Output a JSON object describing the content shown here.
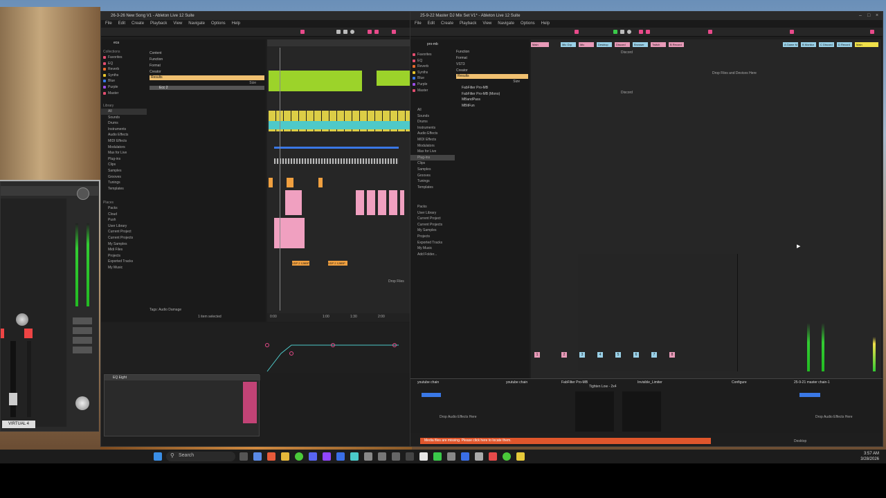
{
  "left_window": {
    "title": "26-3-26 New Song V1 - Ableton Live 12 Suite",
    "menus": [
      "File",
      "Edit",
      "Create",
      "Playback",
      "View",
      "Navigate",
      "Options",
      "Help"
    ],
    "search_value": "eca",
    "browser_filters": [
      "Content",
      "Function",
      "Format",
      "Creator"
    ],
    "results_label": "Results",
    "size_label": "Size",
    "result_item": "Ecc 2",
    "collections_label": "Collections",
    "collections": [
      {
        "label": "Favorites",
        "color": "#e34d6f"
      },
      {
        "label": "EQ",
        "color": "#e34d6f"
      },
      {
        "label": "Reverb",
        "color": "#e86a2c"
      },
      {
        "label": "Synths",
        "color": "#e8c42c"
      },
      {
        "label": "Blue",
        "color": "#3a78e6"
      },
      {
        "label": "Purple",
        "color": "#9a4de6"
      },
      {
        "label": "Master",
        "color": "#e34d6f"
      }
    ],
    "library_label": "Library",
    "library": [
      "All",
      "Sounds",
      "Drums",
      "Instruments",
      "Audio Effects",
      "MIDI Effects",
      "Modulators",
      "Max for Live",
      "Plug-ins",
      "Clips",
      "Samples",
      "Grooves",
      "Tunings",
      "Templates"
    ],
    "places_label": "Places",
    "places": [
      "Packs",
      "Cloud",
      "Push",
      "User Library",
      "Current Project",
      "Current Projects",
      "My Samples",
      "Midi Files",
      "Projects",
      "Exported Tracks",
      "My Music"
    ],
    "tags_label": "Tags",
    "tags_value": "Audio Damage",
    "status": "1 item selected",
    "drop_files": "Drop Files",
    "clip_labels": [
      "VDP 2 128BP",
      "VDP 2 128BP"
    ],
    "device_title": "EQ Eight",
    "timeline_markers": [
      "0:00",
      "1:00",
      "1:30",
      "2:00"
    ]
  },
  "right_window": {
    "title": "25-9-22 Master DJ Mix Set V1* - Ableton Live 12 Suite",
    "menus": [
      "File",
      "Edit",
      "Create",
      "Playback",
      "View",
      "Navigate",
      "Options",
      "Help"
    ],
    "search_value": "pro-mb",
    "browser_filters": [
      "Function",
      "Format",
      "VST3",
      "Creator"
    ],
    "results_label": "Results",
    "size_label": "Size",
    "results": [
      "FabFilter Pro-MB",
      "FabFilter Pro-MB (Mono)",
      "MBandPass",
      "MBitFun"
    ],
    "collections": [
      {
        "label": "Favorites",
        "color": "#e34d6f"
      },
      {
        "label": "EQ",
        "color": "#e34d6f"
      },
      {
        "label": "Reverb",
        "color": "#e86a2c"
      },
      {
        "label": "Synths",
        "color": "#e8c42c"
      },
      {
        "label": "Blue",
        "color": "#3a78e6"
      },
      {
        "label": "Purple",
        "color": "#9a4de6"
      },
      {
        "label": "Master",
        "color": "#e34d6f"
      }
    ],
    "library": [
      "All",
      "Sounds",
      "Drums",
      "Instruments",
      "Audio Effects",
      "MIDI Effects",
      "Modulators",
      "Max for Live",
      "Plug-ins",
      "Clips",
      "Samples",
      "Grooves",
      "Tunings",
      "Templates"
    ],
    "places": [
      "Packs",
      "User Library",
      "Current Project",
      "Current Projects",
      "My Samples",
      "Projects",
      "Exported Tracks",
      "My Music",
      "Add Folder..."
    ],
    "drop_text": "Drop Files and Devices Here",
    "discord_labels": [
      "Discord",
      "Discord"
    ],
    "tracks": [
      {
        "name": "Main",
        "color": "#e89ab8"
      },
      {
        "name": "Mic Grp",
        "color": "#9ad1e8"
      },
      {
        "name": "Mic",
        "color": "#e89ab8"
      },
      {
        "name": "Desktop",
        "color": "#9ad1e8"
      },
      {
        "name": "Discord",
        "color": "#e89ab8"
      },
      {
        "name": "Browser",
        "color": "#9ad1e8"
      },
      {
        "name": "Twitch",
        "color": "#e89ab8"
      },
      {
        "name": "B Record",
        "color": "#e89ab8"
      }
    ],
    "return_tracks": [
      {
        "name": "A Game M",
        "color": "#9ad1e8"
      },
      {
        "name": "B Monitor",
        "color": "#9ad1e8"
      },
      {
        "name": "C Discord",
        "color": "#9ad1e8"
      },
      {
        "name": "D Record",
        "color": "#9ad1e8"
      },
      {
        "name": "Main",
        "color": "#f0e04a"
      }
    ],
    "track_numbers": [
      "1",
      "2",
      "3",
      "4",
      "5",
      "6",
      "7",
      "8"
    ],
    "device_chain_1": "youtube chain",
    "device_chain_2": "youtube chain",
    "device_3": "FabFilter Pro-MB",
    "device_4": "Tighten Low - 2x4",
    "device_5": "Invisible_Limiter",
    "device_6": "25-9-21 master chain-1",
    "drop_audio_effects": "Drop Audio Effects Here",
    "configure_label": "Configure",
    "status_message": "Media files are missing. Please click here to locate them.",
    "desktop_label": "Desktop"
  },
  "uad_window": {
    "brand": "VIRTUAL 4",
    "labels": [
      "INSERT EFFECTS",
      "SHOW",
      "OUTPUT",
      "MONITOR",
      "UNISON"
    ]
  },
  "taskbar": {
    "search_placeholder": "Search",
    "time": "3:57 AM",
    "date": "3/28/2026"
  }
}
